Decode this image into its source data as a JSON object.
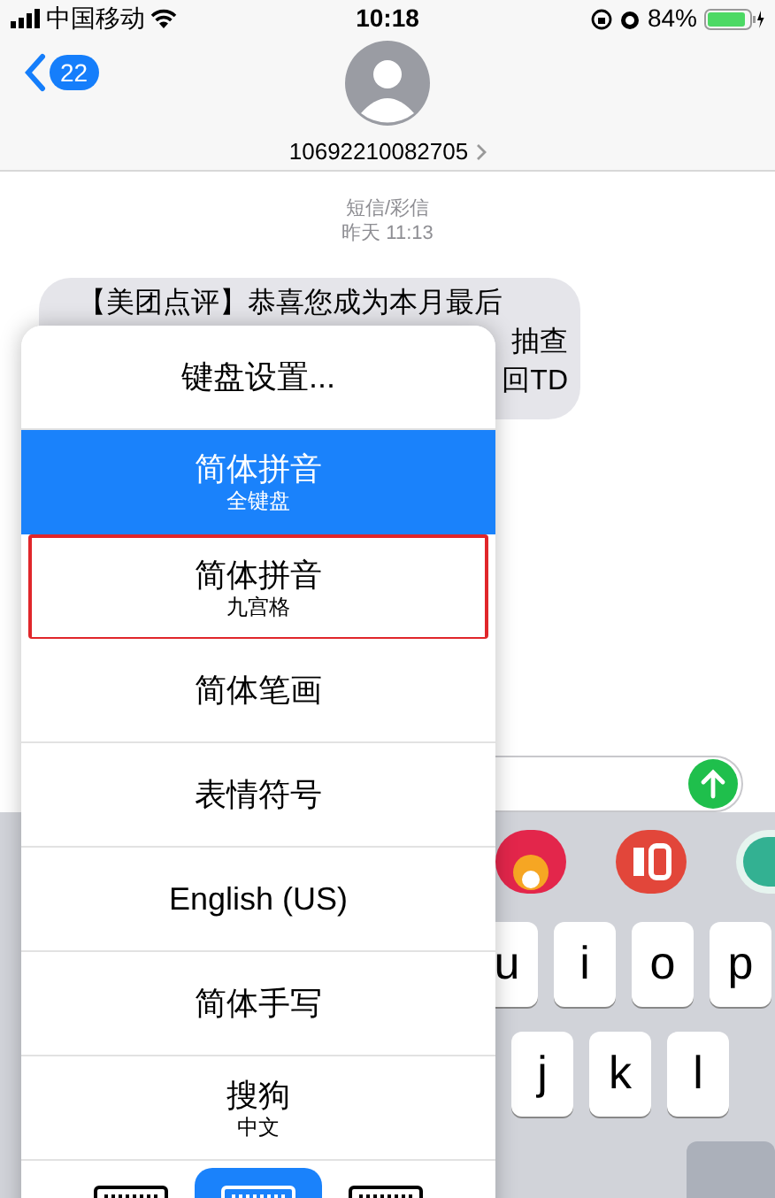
{
  "status_bar": {
    "carrier": "中国移动",
    "time": "10:18",
    "battery": "84%"
  },
  "header": {
    "back_count": "22",
    "contact": "10692210082705"
  },
  "thread": {
    "service": "短信/彩信",
    "timestamp": "昨天 11:13",
    "message_lines": [
      "【美团点评】恭喜您成为本月最后",
      "抽查",
      "回TD"
    ]
  },
  "keyboard": {
    "row_1": [
      "u",
      "i",
      "o",
      "p"
    ],
    "row_2": [
      "j",
      "k",
      "l"
    ]
  },
  "input_menu": {
    "items": [
      {
        "label": "键盘设置...",
        "selected": false,
        "highlighted": false
      },
      {
        "label": "简体拼音",
        "sublabel": "全键盘",
        "selected": true,
        "highlighted": false
      },
      {
        "label": "简体拼音",
        "sublabel": "九宫格",
        "selected": false,
        "highlighted": true
      },
      {
        "label": "简体笔画",
        "selected": false,
        "highlighted": false
      },
      {
        "label": "表情符号",
        "selected": false,
        "highlighted": false
      },
      {
        "label": "English (US)",
        "selected": false,
        "highlighted": false
      },
      {
        "label": "简体手写",
        "selected": false,
        "highlighted": false
      },
      {
        "label": "搜狗",
        "sublabel": "中文",
        "selected": false,
        "highlighted": false
      }
    ],
    "keyboard_modes": [
      {
        "selected": false
      },
      {
        "selected": true
      },
      {
        "selected": false
      }
    ]
  }
}
